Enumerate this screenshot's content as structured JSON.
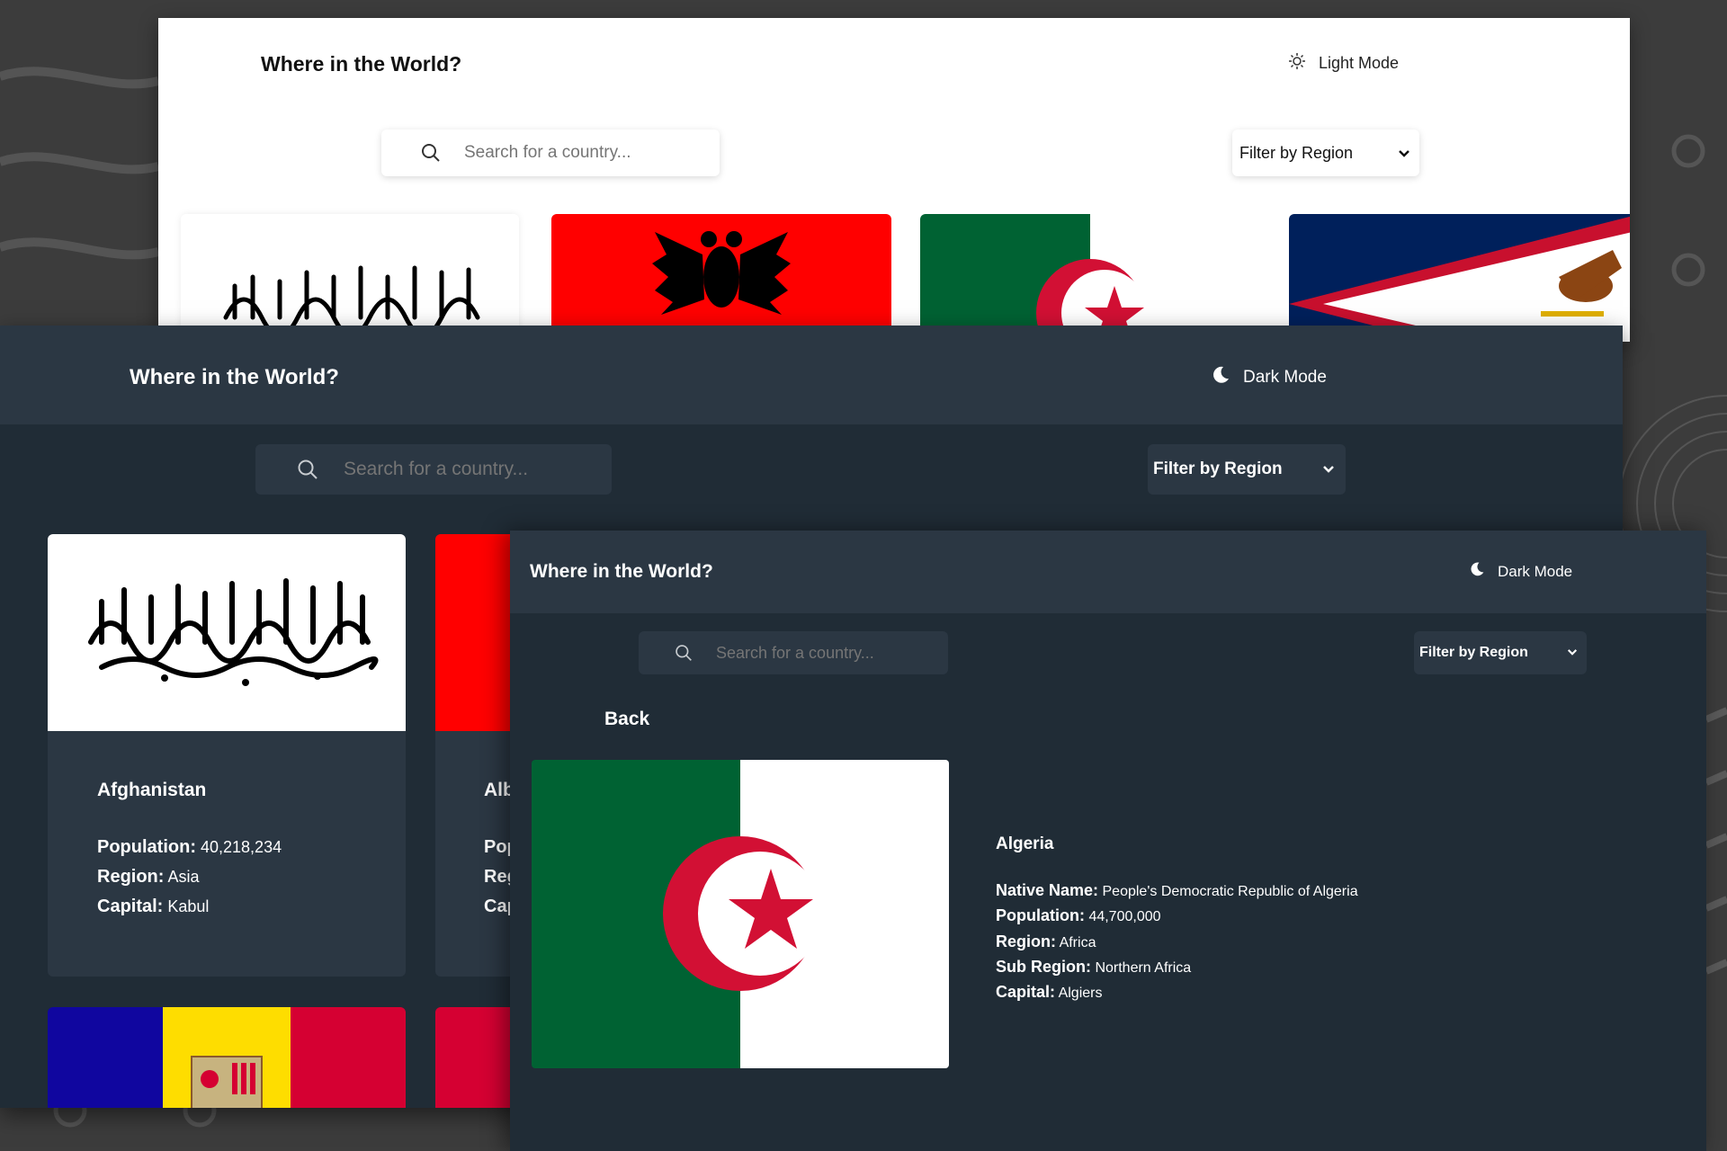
{
  "app_title": "Where in the World?",
  "light_view": {
    "mode_label": "Light Mode",
    "search_placeholder": "Search for a country...",
    "filter_label": "Filter by Region"
  },
  "dark_view": {
    "mode_label": "Dark Mode",
    "search_placeholder": "Search for a country...",
    "filter_label": "Filter by Region",
    "cards": [
      {
        "name": "Afghanistan",
        "population_label": "Population:",
        "population": "40,218,234",
        "region_label": "Region:",
        "region": "Asia",
        "capital_label": "Capital:",
        "capital": "Kabul"
      }
    ],
    "partial_card": {
      "name": "Alb",
      "population_label": "Pop",
      "region_label": "Reg",
      "capital_label": "Cap"
    }
  },
  "detail_view": {
    "mode_label": "Dark Mode",
    "search_placeholder": "Search for a country...",
    "filter_label": "Filter by Region",
    "back_label": "Back",
    "country": {
      "name": "Algeria",
      "native_name_label": "Native Name:",
      "native_name": "People's Democratic Republic of Algeria",
      "population_label": "Population:",
      "population": "44,700,000",
      "region_label": "Region:",
      "region": "Africa",
      "subregion_label": "Sub Region:",
      "subregion": "Northern Africa",
      "capital_label": "Capital:",
      "capital": "Algiers"
    }
  },
  "colors": {
    "dark_bg": "#202c36",
    "dark_elements": "#2b3743",
    "light_bg": "#ffffff",
    "albania_red": "#ff0000",
    "algeria_green": "#006233",
    "algeria_red": "#d21034",
    "andorra_blue": "#10069f",
    "andorra_yellow": "#fedd00"
  }
}
